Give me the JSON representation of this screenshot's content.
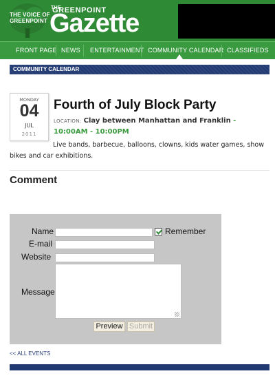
{
  "masthead": {
    "tagline": [
      "THE VOICE OF",
      "GREENPOINT"
    ],
    "brand_the": "THE",
    "brand_name": "GREENPOINT",
    "brand_title": "Gazette"
  },
  "nav": {
    "items": [
      "FRONT PAGE",
      "NEWS",
      "ENTERTAINMENT",
      "COMMUNITY CALENDAR",
      "CLASSIFIEDS"
    ],
    "active": "COMMUNITY CALENDAR"
  },
  "section": {
    "title": "COMMUNITY CALENDAR"
  },
  "event": {
    "date": {
      "weekday": "MONDAY",
      "day": "04",
      "month": "JUL",
      "year": "2011"
    },
    "title": "Fourth of July Block Party",
    "location_label": "LOCATION:",
    "location": "Clay between Manhattan and Franklin",
    "time_separator": " - ",
    "time": "10:00AM - 10:00PM",
    "description": "Live bands, barbecue, balloons, clowns, kids water games, show bikes and car exhibitions."
  },
  "comment": {
    "heading": "Comment",
    "name_label": "Name",
    "email_label": "E-mail",
    "website_label": "Website",
    "message_label": "Message",
    "remember_label": "Remember",
    "remember_checked": true,
    "name_value": "",
    "email_value": "",
    "website_value": "",
    "message_value": "",
    "preview_label": "Preview",
    "submit_label": "Submit"
  },
  "footer": {
    "all_events_label": "<< ALL EVENTS"
  },
  "colors": {
    "brand_green": "#2f8a36",
    "nav_green": "#3a9a40",
    "navy": "#223a72",
    "time_green": "#3a9a40"
  }
}
